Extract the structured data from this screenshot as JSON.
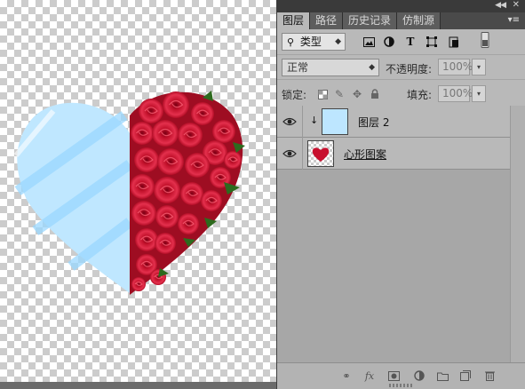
{
  "canvas": {
    "rose_red": "#d21734",
    "blue_light": "#bfe7ff",
    "blue_stripe": "#8fd3ff"
  },
  "panel": {
    "tabs": [
      {
        "label": "图层",
        "active": true
      },
      {
        "label": "路径",
        "active": false
      },
      {
        "label": "历史记录",
        "active": false
      },
      {
        "label": "仿制源",
        "active": false
      }
    ],
    "filter": {
      "kind_label": "类型",
      "icons": [
        "image-filter-icon",
        "adjustment-filter-icon",
        "type-filter-icon",
        "shape-filter-icon",
        "smart-object-filter-icon",
        "filter-toggle-icon"
      ]
    },
    "blend": {
      "mode": "正常",
      "opacity_label": "不透明度:",
      "opacity_value": "100%"
    },
    "lock": {
      "label": "锁定:",
      "fill_label": "填充:",
      "fill_value": "100%"
    },
    "layers": [
      {
        "name": "图层 2",
        "visible": true,
        "clipped": true,
        "clip_symbol": "↓"
      },
      {
        "name": "心形图案",
        "visible": true,
        "clipped": false
      }
    ],
    "bottom_icons": [
      "link-layers-icon",
      "fx-icon",
      "add-mask-icon",
      "new-adjustment-icon",
      "new-group-icon",
      "new-layer-icon",
      "delete-layer-icon"
    ],
    "fx_label": "fx"
  }
}
